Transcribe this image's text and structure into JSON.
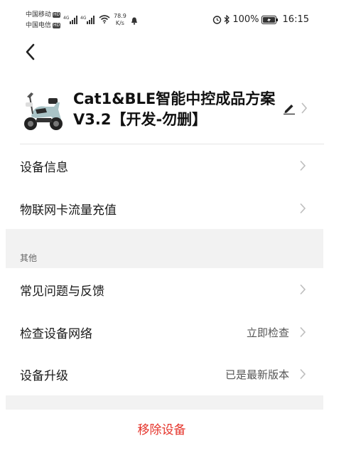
{
  "status_bar": {
    "carrier1": "中国移动",
    "carrier2": "中国电信",
    "hd_badge": "HD",
    "signal_label1": "4G",
    "signal_label2": "4G",
    "net_speed_value": "78.9",
    "net_speed_unit": "K/s",
    "battery": "100%",
    "time": "16:15"
  },
  "header": {
    "device_name": "Cat1&BLE智能中控成品方案V3.2【开发-勿删】"
  },
  "menu": {
    "device_info": "设备信息",
    "sim_topup": "物联网卡流量充值",
    "section_other": "其他",
    "faq": "常见问题与反馈",
    "check_network": "检查设备网络",
    "check_network_value": "立即检查",
    "upgrade": "设备升级",
    "upgrade_value": "已是最新版本"
  },
  "remove_button": "移除设备",
  "colors": {
    "remove": "#e5332a",
    "band": "#f2f2f2"
  }
}
